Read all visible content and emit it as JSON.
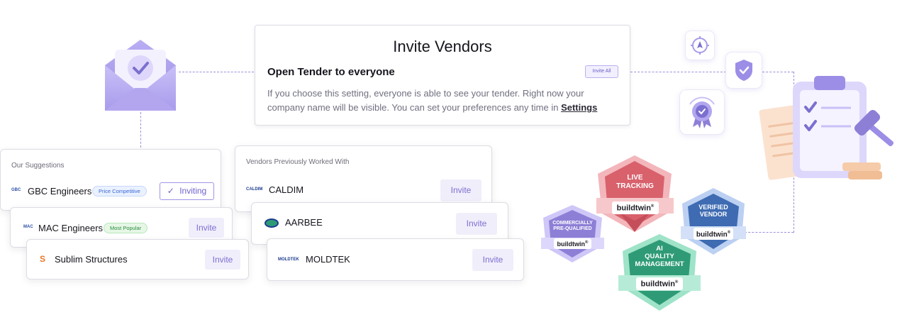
{
  "invite_card": {
    "title": "Invite Vendors",
    "open_tender_title": "Open Tender to everyone",
    "invite_all_label": "Invite All",
    "description": "If you choose this setting, everyone is able to see your tender. Right now your company name will be visible. You can set your preferences any time in ",
    "settings_link": "Settings"
  },
  "suggestions": {
    "label": "Our Suggestions",
    "items": [
      {
        "name": "GBC Engineers",
        "logo_text": "GBC",
        "tag": "Price Competitive",
        "button": "Inviting"
      },
      {
        "name": "MAC Engineers",
        "logo_text": "MAC",
        "tag": "Most Popular",
        "button": "Invite"
      },
      {
        "name": "Sublim Structures",
        "logo_text": "S",
        "button": "Invite"
      }
    ]
  },
  "previous": {
    "label": "Vendors Previously Worked With",
    "items": [
      {
        "name": "CALDIM",
        "logo_text": "CALDIM",
        "button": "Invite"
      },
      {
        "name": "AARBEE",
        "logo_text": "AARBEE",
        "button": "Invite"
      },
      {
        "name": "MOLDTEK",
        "logo_text": "MOLDTEK",
        "button": "Invite"
      }
    ]
  },
  "badges": {
    "brand": "buildtwin",
    "registered": "®",
    "live_tracking": "LIVE\nTRACKING",
    "commercially": "COMMERCIALLY\nPRE-QUALIFIED",
    "verified": "VERIFIED\nVENDOR",
    "ai_quality": "AI\nQUALITY\nMANAGEMENT"
  },
  "icons": [
    "envelope-check-icon",
    "target-icon",
    "shield-check-icon",
    "award-ribbon-icon",
    "clipboard-checklist-icon",
    "gavel-icon",
    "check-icon"
  ],
  "colors": {
    "accent": "#7b6fd0",
    "badge_red": "#d8616c",
    "badge_blue": "#3e6bb2",
    "badge_purple": "#8d7fd6",
    "badge_green": "#2e9b76"
  }
}
